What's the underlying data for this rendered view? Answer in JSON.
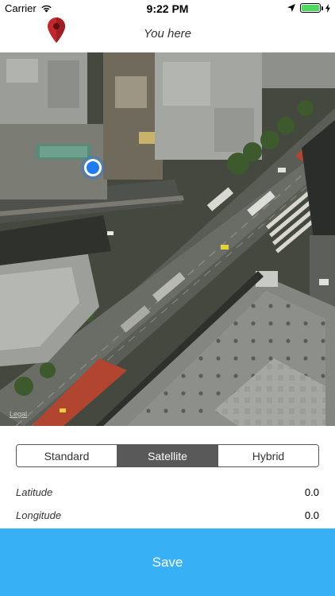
{
  "status_bar": {
    "carrier": "Carrier",
    "time": "9:22 PM"
  },
  "nav": {
    "title": "You here",
    "pin_icon": "map-pin-icon",
    "pin_color": "#c1272d"
  },
  "map": {
    "legal_label": "Legal",
    "location_dot_color": "#1e7cf2"
  },
  "map_type": {
    "options": [
      "Standard",
      "Satellite",
      "Hybrid"
    ],
    "selected": "Satellite"
  },
  "coordinates": {
    "latitude_label": "Latitude",
    "latitude_value": "0.0",
    "longitude_label": "Longitude",
    "longitude_value": "0.0"
  },
  "save_label": "Save",
  "colors": {
    "accent": "#38b0f5",
    "segment_active": "#595959"
  }
}
